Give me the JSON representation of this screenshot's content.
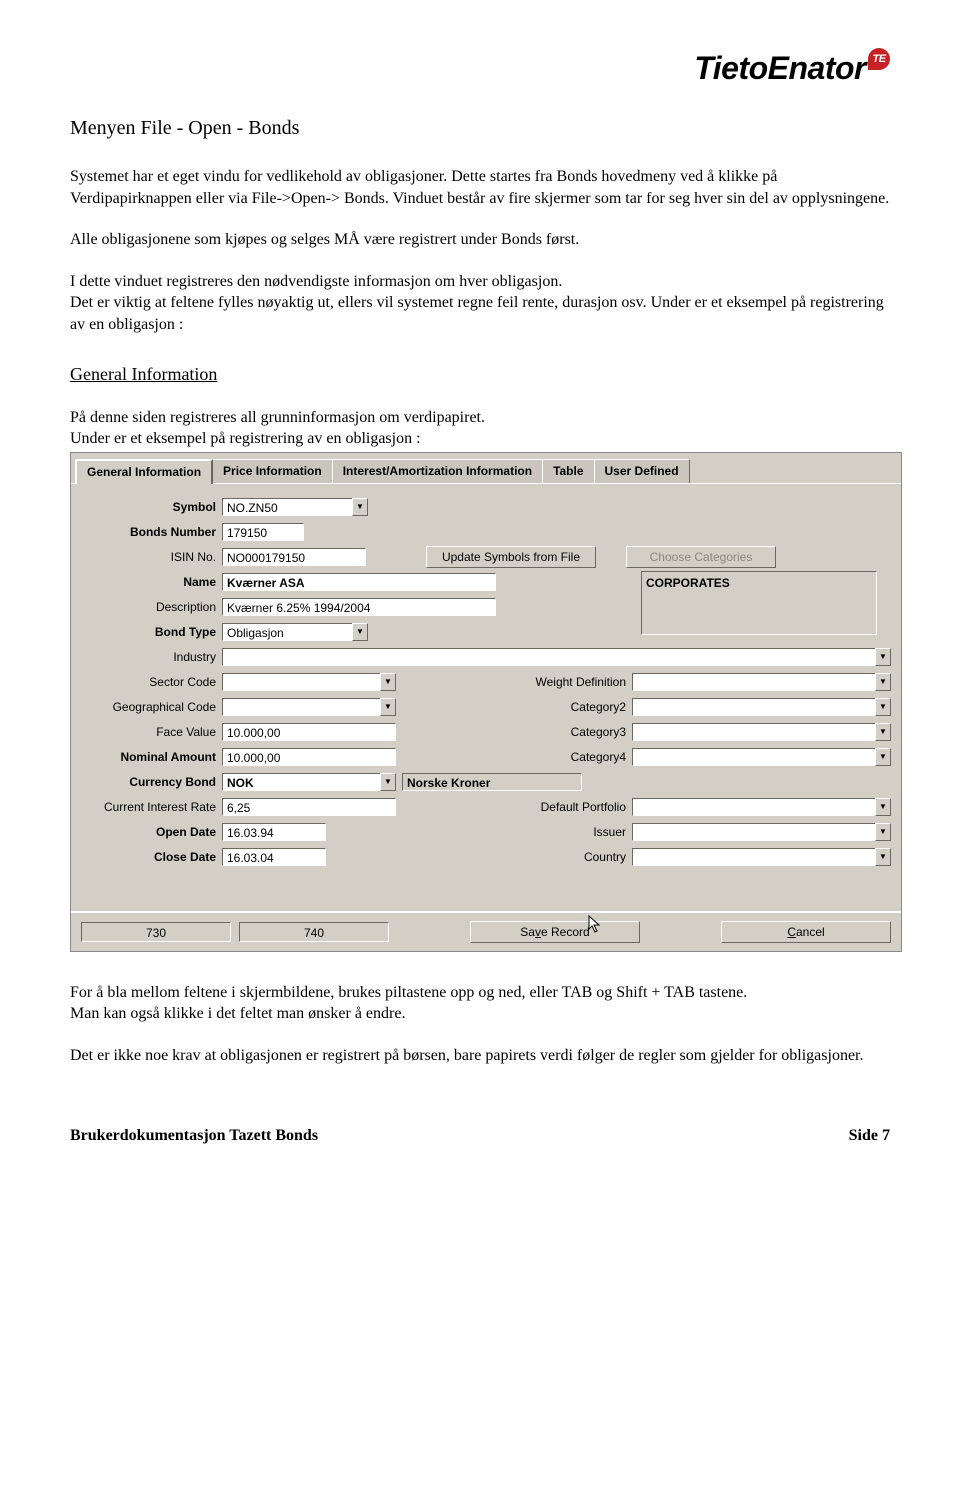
{
  "logo": {
    "brand": "TietoEnator",
    "badge": "TE"
  },
  "title": "Menyen File - Open - Bonds",
  "para1": "Systemet har et eget vindu for vedlikehold av obligasjoner. Dette startes fra Bonds hovedmeny ved å klikke på Verdipapirknappen eller via File->Open-> Bonds.  Vinduet består av fire skjermer som tar for seg hver sin del av opplysningene.",
  "para2": "Alle obligasjonene som kjøpes og selges MÅ være registrert under Bonds først.",
  "para3": "I dette vinduet registreres den nødvendigste informasjon om hver obligasjon.",
  "para4": "Det er viktig at feltene fylles nøyaktig ut, ellers vil systemet regne feil rente, durasjon osv.  Under er et eksempel på registrering av en obligasjon :",
  "subhead": "General Information",
  "para5": "På denne siden registreres all grunninformasjon om verdipapiret.",
  "para6": "Under er et eksempel på registrering av en obligasjon :",
  "tabs": {
    "general": "General Information",
    "price": "Price Information",
    "interest": "Interest/Amortization Information",
    "table": "Table",
    "user": "User Defined"
  },
  "labels": {
    "symbol": "Symbol",
    "bonds_number": "Bonds Number",
    "isin": "ISIN No.",
    "name": "Name",
    "description": "Description",
    "bond_type": "Bond Type",
    "industry": "Industry",
    "sector_code": "Sector Code",
    "geo_code": "Geographical Code",
    "face_value": "Face Value",
    "nominal_amount": "Nominal Amount",
    "currency_bond": "Currency Bond",
    "current_interest": "Current Interest Rate",
    "open_date": "Open Date",
    "close_date": "Close Date",
    "weight_def": "Weight Definition",
    "cat2": "Category2",
    "cat3": "Category3",
    "cat4": "Category4",
    "default_portfolio": "Default Portfolio",
    "issuer": "Issuer",
    "country": "Country"
  },
  "values": {
    "symbol": "NO.ZN50",
    "bonds_number": "179150",
    "isin": "NO000179150",
    "name": "Kværner ASA",
    "description": "Kværner 6.25% 1994/2004",
    "bond_type": "Obligasjon",
    "industry": "",
    "sector_code": "",
    "geo_code": "",
    "face_value": "10.000,00",
    "nominal_amount": "10.000,00",
    "currency_bond": "NOK",
    "currency_name": "Norske Kroner",
    "current_interest": "6,25",
    "open_date": "16.03.94",
    "close_date": "16.03.04",
    "category_box": "CORPORATES",
    "weight_def": "",
    "cat2": "",
    "cat3": "",
    "cat4": "",
    "default_portfolio": "",
    "issuer": "",
    "country": ""
  },
  "buttons": {
    "update_symbols": "Update Symbols from File",
    "choose_categories": "Choose Categories",
    "save_prefix": "Sa",
    "save_key": "v",
    "save_suffix": "e Record",
    "cancel_key": "C",
    "cancel_suffix": "ancel"
  },
  "status": {
    "left": "730",
    "right": "740"
  },
  "para7": "For å bla mellom feltene i skjermbildene, brukes piltastene opp og ned, eller TAB og Shift + TAB tastene.",
  "para8": "Man kan også klikke i det feltet man ønsker å endre.",
  "para9": "Det er ikke noe krav at obligasjonen er registrert på børsen, bare papirets verdi følger de regler som gjelder for obligasjoner.",
  "footer": {
    "left": "Brukerdokumentasjon Tazett Bonds",
    "right": "Side 7"
  }
}
